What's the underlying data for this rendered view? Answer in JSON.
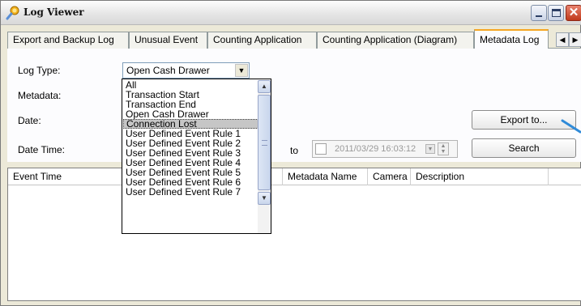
{
  "window": {
    "title": "Log Viewer"
  },
  "tabs": [
    {
      "label": "Export and Backup Log",
      "active": false
    },
    {
      "label": "Unusual Event",
      "active": false
    },
    {
      "label": "Counting Application",
      "active": false
    },
    {
      "label": "Counting Application (Diagram)",
      "active": false
    },
    {
      "label": "Metadata Log",
      "active": true
    }
  ],
  "tab_scroll": {
    "left": "◀",
    "right": "▶"
  },
  "form": {
    "log_type_label": "Log Type:",
    "log_type_value": "Open Cash Drawer",
    "metadata_label": "Metadata:",
    "date_label": "Date:",
    "date_time_label": "Date Time:",
    "to_label": "to",
    "date_time_to_value": "2011/03/29 16:03:12",
    "export_button": "Export to...",
    "search_button": "Search"
  },
  "log_type_options": [
    "All",
    "Transaction Start",
    "Transaction End",
    "Open Cash Drawer",
    "Connection Lost",
    "User Defined Event Rule 1",
    "User Defined Event Rule 2",
    "User Defined Event Rule 3",
    "User Defined Event Rule 4",
    "User Defined Event Rule 5",
    "User Defined Event Rule 6",
    "User Defined Event Rule 7"
  ],
  "highlighted_option": "Connection Lost",
  "table": {
    "columns": [
      "Event Time",
      "Metadata Name",
      "Camera",
      "Description"
    ],
    "rows": []
  },
  "colors": {
    "active_tab_accent": "#f5a623",
    "close_button": "#c0391b",
    "arrow_decoration": "#2f8ad8"
  }
}
